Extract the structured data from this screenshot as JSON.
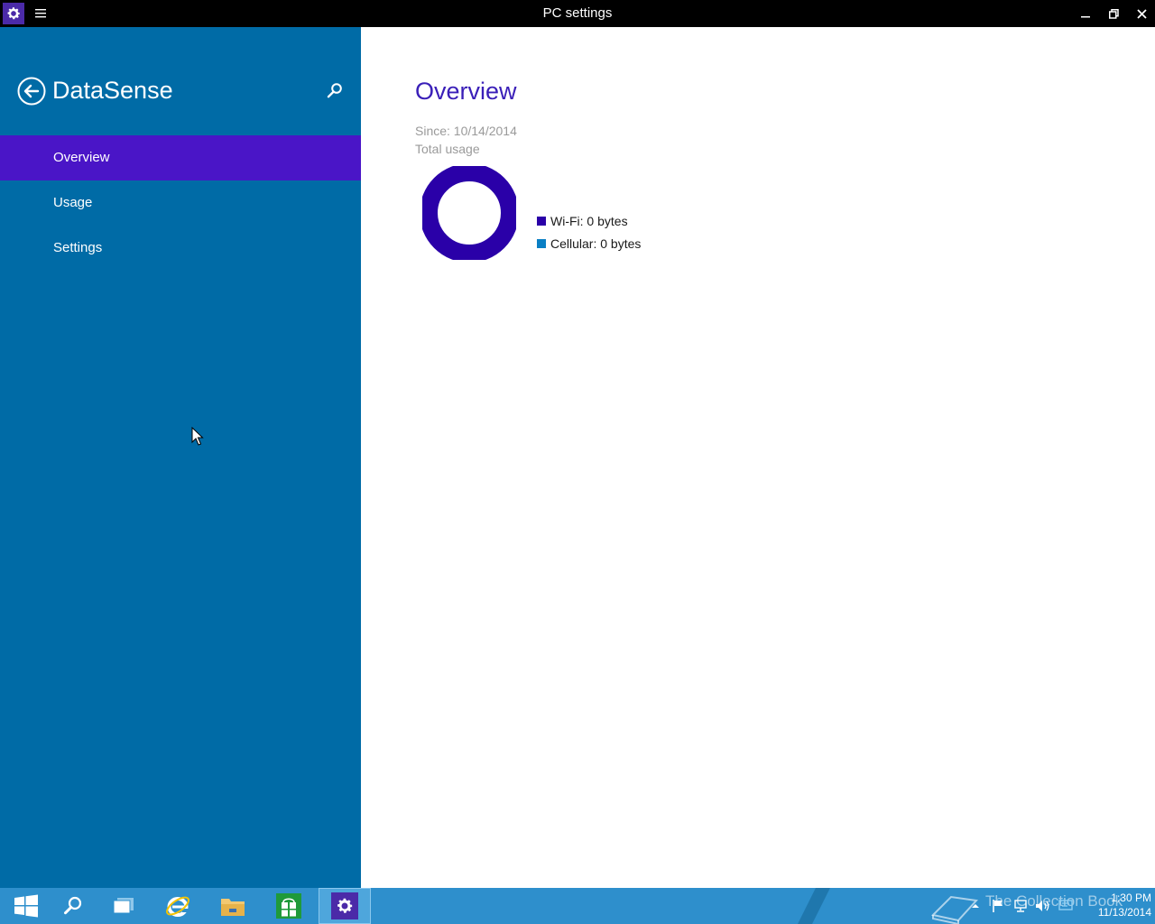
{
  "window": {
    "title": "PC settings"
  },
  "sidebar": {
    "title": "DataSense",
    "items": [
      {
        "label": "Overview",
        "selected": true
      },
      {
        "label": "Usage",
        "selected": false
      },
      {
        "label": "Settings",
        "selected": false
      }
    ]
  },
  "content": {
    "title": "Overview",
    "since": "Since: 10/14/2014",
    "total_usage_label": "Total usage",
    "legend": [
      {
        "label": "Wi-Fi: 0 bytes",
        "color": "#2a00a8"
      },
      {
        "label": "Cellular: 0 bytes",
        "color": "#0a7fc4"
      }
    ]
  },
  "colors": {
    "sidebar_bg": "#006ba6",
    "selected_item": "#4a15c7",
    "accent_title": "#3a1fb8",
    "taskbar_bg": "#2e8fcc"
  },
  "taskbar": {
    "watermark": "The Collection Book",
    "clock": {
      "time": "1:30 PM",
      "date": "11/13/2014"
    }
  }
}
